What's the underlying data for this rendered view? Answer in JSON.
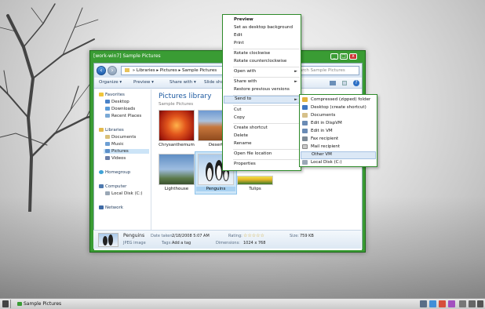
{
  "window": {
    "title": "[work-win7] Sample Pictures",
    "controls": {
      "minimize": "_",
      "maximize": "□",
      "close": "x"
    }
  },
  "address": {
    "crumbs": [
      "Libraries",
      "Pictures",
      "Sample Pictures"
    ],
    "search_placeholder": "Search Sample Pictures"
  },
  "commandbar": {
    "organize": "Organize ▾",
    "preview": "Preview ▾",
    "share": "Share with ▾",
    "slideshow": "Slide show"
  },
  "nav": {
    "favorites": "Favorites",
    "desktop": "Desktop",
    "downloads": "Downloads",
    "recent": "Recent Places",
    "libraries": "Libraries",
    "documents": "Documents",
    "music": "Music",
    "pictures": "Pictures",
    "videos": "Videos",
    "homegroup": "Homegroup",
    "computer": "Computer",
    "localdisk": "Local Disk (C:)",
    "network": "Network"
  },
  "library": {
    "title": "Pictures library",
    "subtitle": "Sample Pictures",
    "items": [
      "Chrysanthemum",
      "Desert",
      "Lighthouse",
      "Penguins",
      "Tulips"
    ]
  },
  "details": {
    "name": "Penguins",
    "type": "JPEG image",
    "date_label": "Date taken:",
    "date_value": "2/18/2008 5:07 AM",
    "tags_label": "Tags:",
    "tags_value": "Add a tag",
    "rating_label": "Rating:",
    "rating_value": "☆☆☆☆☆",
    "dim_label": "Dimensions:",
    "dim_value": "1024 x 768",
    "size_label": "Size:",
    "size_value": "759 KB"
  },
  "context_menu": {
    "preview": "Preview",
    "set_bg": "Set as desktop background",
    "edit": "Edit",
    "print": "Print",
    "rot_cw": "Rotate clockwise",
    "rot_ccw": "Rotate counterclockwise",
    "open_with": "Open with",
    "share_with": "Share with",
    "restore": "Restore previous versions",
    "send_to": "Send to",
    "cut": "Cut",
    "copy": "Copy",
    "shortcut": "Create shortcut",
    "delete": "Delete",
    "rename": "Rename",
    "open_loc": "Open file location",
    "properties": "Properties",
    "arrow": "►"
  },
  "sendto_menu": {
    "zip": "Compressed (zipped) folder",
    "desktop": "Desktop (create shortcut)",
    "documents": "Documents",
    "dispvm": "Edit in DispVM",
    "editvm": "Edit in VM",
    "fax": "Fax recipient",
    "mail": "Mail recipient",
    "othervm": "Other VM",
    "localdisk": "Local Disk (C:)"
  },
  "taskbar": {
    "task": "Sample Pictures"
  }
}
